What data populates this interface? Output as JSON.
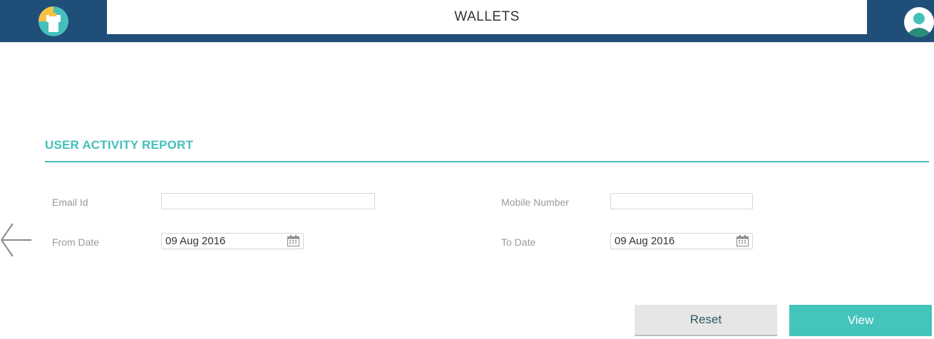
{
  "header": {
    "title": "WALLETS",
    "logo_icon": "wallet-logo-icon",
    "avatar_icon": "user-avatar-icon",
    "bar_color": "#1f4e79"
  },
  "report": {
    "title": "USER ACTIVITY REPORT",
    "accent_color": "#45bfbb"
  },
  "form": {
    "email_label": "Email Id",
    "email_value": "",
    "mobile_label": "Mobile Number",
    "mobile_value": "",
    "from_label": "From Date",
    "from_value": "09 Aug 2016",
    "to_label": "To Date",
    "to_value": "09 Aug 2016"
  },
  "actions": {
    "reset_label": "Reset",
    "view_label": "View"
  }
}
